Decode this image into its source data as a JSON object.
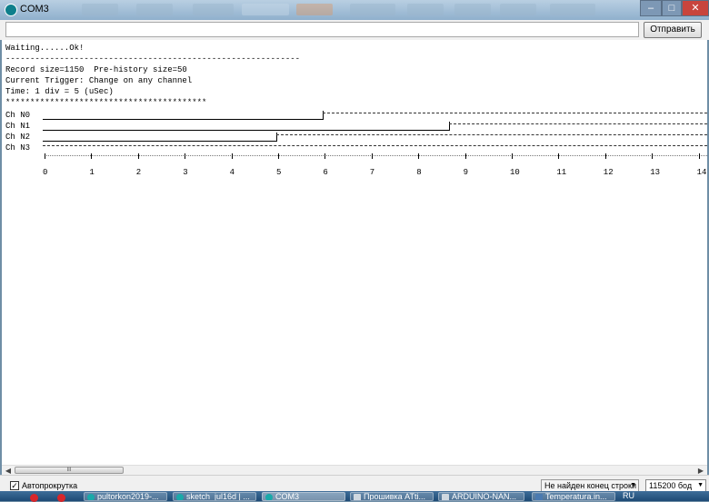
{
  "window": {
    "title": "COM3",
    "controls": {
      "minimize": "–",
      "maximize": "□",
      "close": "✕"
    }
  },
  "toolbar": {
    "input_value": "",
    "send_label": "Отправить"
  },
  "output": {
    "lines": [
      "Waiting......Ok!",
      "------------------------------------------------------------",
      "Record size=1150  Pre-history size=50",
      "Current Trigger: Change on any channel",
      "Time: 1 div = 5 (uSec)",
      "*****************************************"
    ],
    "channels": [
      "Ch N0",
      "Ch N1",
      "Ch N2",
      "Ch N3"
    ],
    "ruler_labels": [
      "0",
      "1",
      "2",
      "3",
      "4",
      "5",
      "6",
      "7",
      "8",
      "9",
      "10",
      "11",
      "12",
      "13",
      "14"
    ]
  },
  "hscroll": {
    "thumb_grip": "III"
  },
  "status": {
    "autoscroll_label": "Автопрокрутка",
    "autoscroll_checked": true,
    "checkmark": "✓",
    "line_ending": "Не найден конец строки",
    "baud": "115200 бод"
  },
  "taskbar": {
    "items": [
      "pultorkon2019-...",
      "sketch_jul16d | ...",
      "COM3",
      "Прошивка ATti...",
      "ARDUINO-NAN...",
      "Temperatura.in..."
    ],
    "lang": "RU"
  },
  "colors": {
    "accent": "#0e7f8c",
    "taskbar": "#1d4a75"
  }
}
